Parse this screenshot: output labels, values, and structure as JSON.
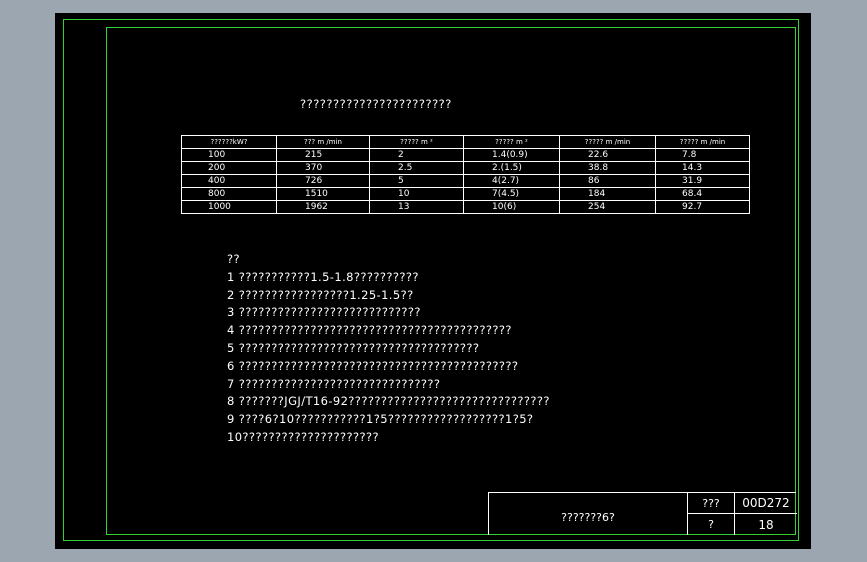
{
  "drawing": {
    "title": "???????????????????????",
    "table": {
      "headers": [
        "??????kW?",
        "??? m  /min",
        "????? m    ²",
        "????? m    ²",
        "????? m  /min",
        "????? m  /min"
      ],
      "rows": [
        [
          "100",
          "215",
          "2",
          "1.4(0.9)",
          "22.6",
          "7.8"
        ],
        [
          "200",
          "370",
          "2.5",
          "2.(1.5)",
          "38.8",
          "14.3"
        ],
        [
          "400",
          "726",
          "5",
          "4(2.7)",
          "86",
          "31.9"
        ],
        [
          "800",
          "1510",
          "10",
          "7(4.5)",
          "184",
          "68.4"
        ],
        [
          "1000",
          "1962",
          "13",
          "10(6)",
          "254",
          "92.7"
        ]
      ]
    },
    "notes": [
      "??",
      "1 ???????????1.5-1.8??????????",
      "2 ?????????????????1.25-1.5??",
      "3 ????????????????????????????",
      "4 ??????????????????????????????????????????",
      "5 ?????????????????????????????????????",
      "6 ???????????????????????????????????????????",
      "7 ???????????????????????????????",
      "8 ???????JGJ/T16-92???????????????????????????????",
      "9 ????6?10???????????1?5??????????????????1?5?",
      "10?????????????????????"
    ],
    "title_block": {
      "name": "???????6?",
      "label_top": "???",
      "value_top": "00D272",
      "label_bottom": "?",
      "value_bottom": "18"
    }
  }
}
